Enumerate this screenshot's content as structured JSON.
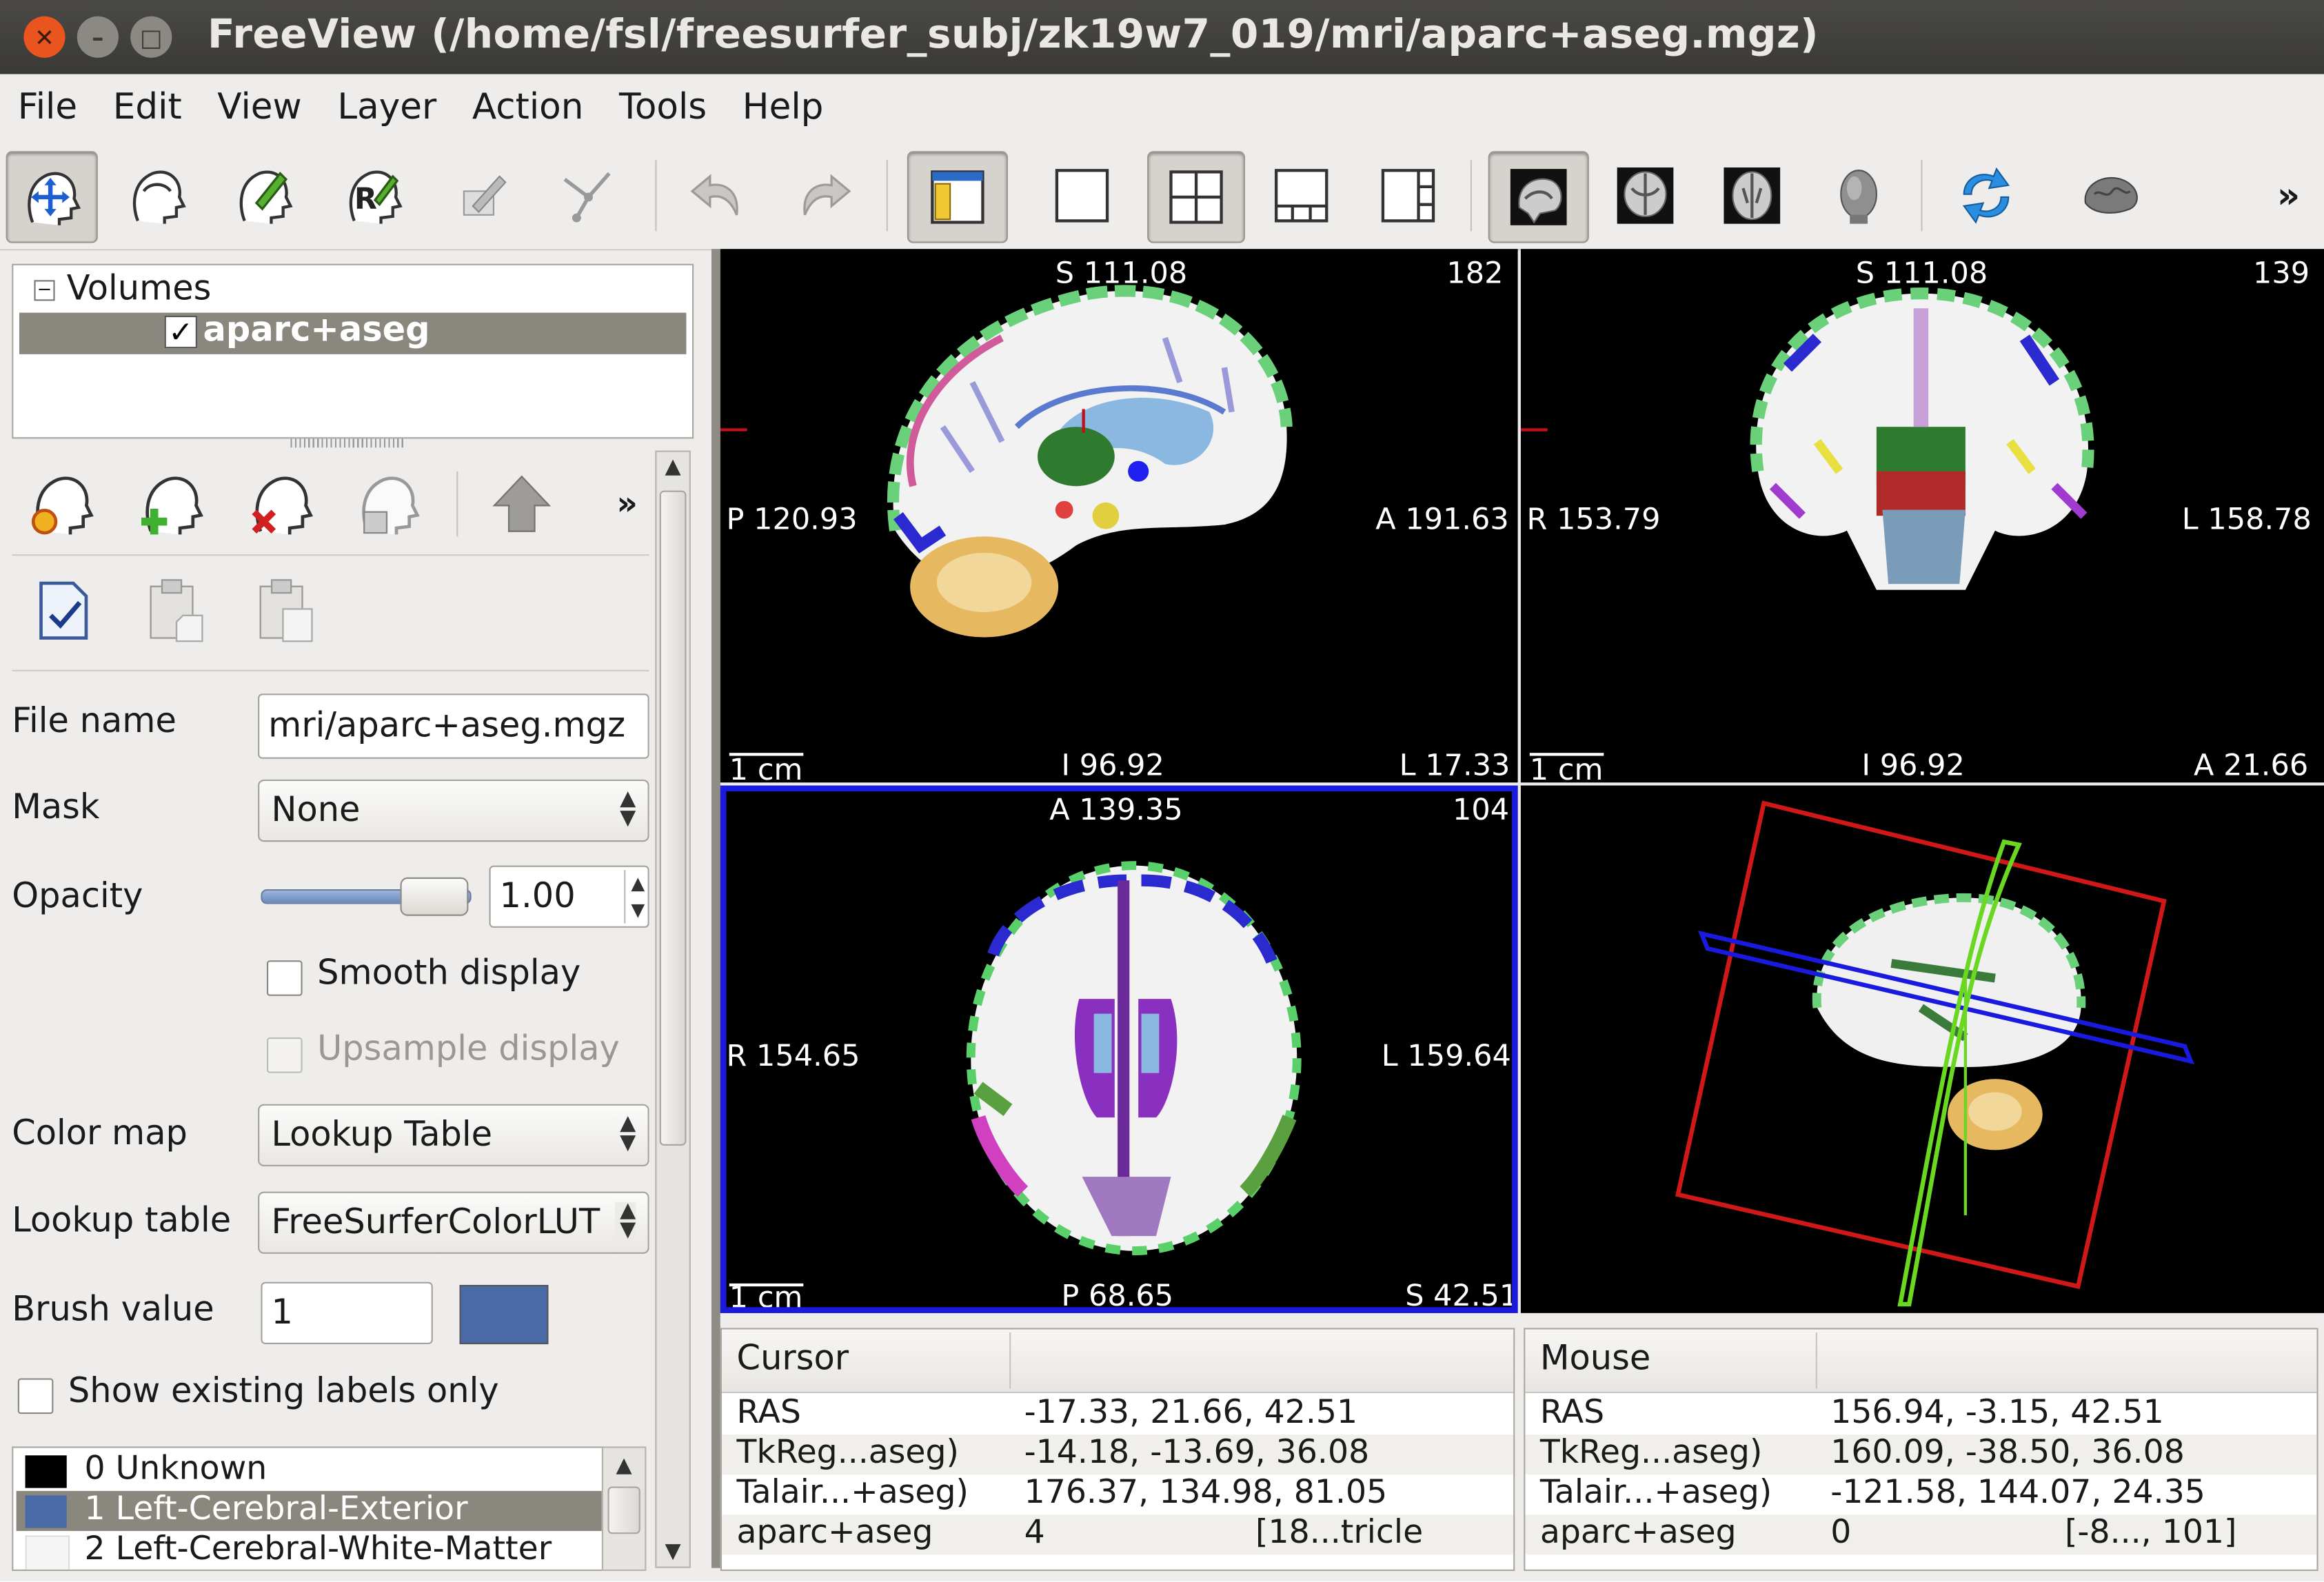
{
  "window": {
    "title": "FreeView (/home/fsl/freesurfer_subj/zk19w7_019/mri/aparc+aseg.mgz)"
  },
  "menu": [
    "File",
    "Edit",
    "View",
    "Layer",
    "Action",
    "Tools",
    "Help"
  ],
  "toolbar": {
    "more_label": "»"
  },
  "layers": {
    "group_label": "Volumes",
    "items": [
      {
        "label": "aparc+aseg",
        "checked": true
      }
    ]
  },
  "panel": {
    "more_label": "»",
    "file_name_label": "File name",
    "file_name_value": "mri/aparc+aseg.mgz",
    "mask_label": "Mask",
    "mask_value": "None",
    "opacity_label": "Opacity",
    "opacity_value": "1.00",
    "opacity_level": 1.0,
    "smooth_display_label": "Smooth display",
    "upsample_display_label": "Upsample display",
    "color_map_label": "Color map",
    "color_map_value": "Lookup Table",
    "lookup_table_label": "Lookup table",
    "lookup_table_value": "FreeSurferColorLUT",
    "brush_value_label": "Brush value",
    "brush_value": "1",
    "brush_color": "#4a6aa5",
    "show_existing_label": "Show existing labels only"
  },
  "labels_list": [
    {
      "text": "0 Unknown",
      "color": "#000000"
    },
    {
      "text": "1 Left-Cerebral-Exterior",
      "color": "#4a6aa5"
    },
    {
      "text": "2 Left-Cerebral-White-Matter",
      "color": "#f5f5f5"
    }
  ],
  "views": {
    "sagittal": {
      "top": "S 111.08",
      "slice": "182",
      "left": "P 120.93",
      "right": "A 191.63",
      "bottom": "I 96.92",
      "bottom_right": "L 17.33",
      "scale": "1 cm"
    },
    "coronal": {
      "top": "S 111.08",
      "slice": "139",
      "left": "R 153.79",
      "right": "L 158.78",
      "bottom": "I 96.92",
      "bottom_right": "A 21.66",
      "scale": "1 cm"
    },
    "axial": {
      "top": "A 139.35",
      "slice": "104",
      "left": "R 154.65",
      "right": "L 159.64",
      "bottom": "P 68.65",
      "bottom_right": "S 42.51",
      "scale": "1 cm"
    }
  },
  "cursor_info": {
    "header": "Cursor",
    "rows": [
      {
        "name": "RAS",
        "value": "-17.33, 21.66, 42.51",
        "extra": ""
      },
      {
        "name": "TkReg...aseg)",
        "value": "-14.18, -13.69, 36.08",
        "extra": ""
      },
      {
        "name": "Talair...+aseg)",
        "value": "176.37, 134.98, 81.05",
        "extra": ""
      },
      {
        "name": "aparc+aseg",
        "value": "4",
        "extra": "[18...tricle"
      }
    ]
  },
  "mouse_info": {
    "header": "Mouse",
    "rows": [
      {
        "name": "RAS",
        "value": "156.94, -3.15, 42.51",
        "extra": ""
      },
      {
        "name": "TkReg...aseg)",
        "value": "160.09, -38.50, 36.08",
        "extra": ""
      },
      {
        "name": "Talair...+aseg)",
        "value": "-121.58, 144.07, 24.35",
        "extra": ""
      },
      {
        "name": "aparc+aseg",
        "value": "0",
        "extra": "[-8..., 101]"
      }
    ]
  },
  "colors": {
    "accent_active_view": "#1a1adf",
    "cursor_marker": "#c0101a",
    "selection": "#8a877f"
  }
}
